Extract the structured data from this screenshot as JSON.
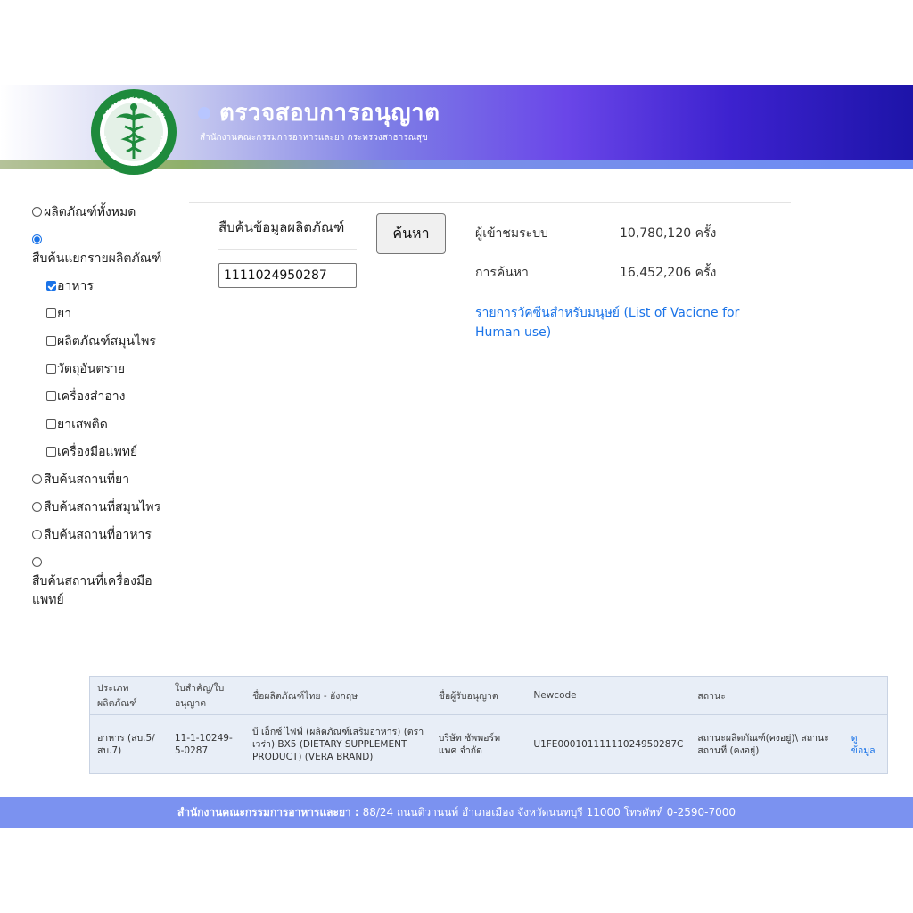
{
  "header": {
    "title": "ตรวจสอบการอนุญาต",
    "subtitle": "สำนักงานคณะกรรมการอาหารและยา กระทรวงสาธารณสุข",
    "logo_top_text": "กระทรวงสาธารณสุข",
    "logo_bottom_text": "MINISTRY OF PUBLIC HEALTH",
    "colors": {
      "banner_start": "#ffffff",
      "banner_mid": "#7e7fe6",
      "banner_end": "#1d14a8",
      "logo_green": "#1e8a3c"
    }
  },
  "sidebar": {
    "options": [
      {
        "label": "ผลิตภัณฑ์ทั้งหมด",
        "checked": false
      },
      {
        "label": "สืบค้นแยกรายผลิตภัณฑ์",
        "checked": true
      },
      {
        "label": "สืบค้นสถานที่ยา",
        "checked": false
      },
      {
        "label": "สืบค้นสถานที่สมุนไพร",
        "checked": false
      },
      {
        "label": "สืบค้นสถานที่อาหาร",
        "checked": false
      },
      {
        "label": "สืบค้นสถานที่เครื่องมือแพทย์",
        "checked": false
      }
    ],
    "categories": [
      {
        "label": "อาหาร",
        "checked": true
      },
      {
        "label": "ยา",
        "checked": false
      },
      {
        "label": "ผลิตภัณฑ์สมุนไพร",
        "checked": false
      },
      {
        "label": "วัตถุอันตราย",
        "checked": false
      },
      {
        "label": "เครื่องสำอาง",
        "checked": false
      },
      {
        "label": "ยาเสพติด",
        "checked": false
      },
      {
        "label": "เครื่องมือแพทย์",
        "checked": false
      }
    ]
  },
  "search": {
    "label": "สืบค้นข้อมูลผลิตภัณฑ์",
    "button": "ค้นหา",
    "value": "1111024950287"
  },
  "stats": {
    "visitors_label": "ผู้เข้าชมระบบ",
    "visitors_value": "10,780,120 ครั้ง",
    "searches_label": "การค้นหา",
    "searches_value": "16,452,206 ครั้ง",
    "vaccine_link": "รายการวัคซีนสำหรับมนุษย์ (List of Vacicne for Human use)"
  },
  "table": {
    "headers": [
      "ประเภทผลิตภัณฑ์",
      "ใบสำคัญ/ใบอนุญาต",
      "ชื่อผลิตภัณฑ์ไทย - อังกฤษ",
      "ชื่อผู้รับอนุญาต",
      "Newcode",
      "สถานะ",
      ""
    ],
    "rows": [
      {
        "type": "อาหาร (สบ.5/สบ.7)",
        "license": "11-1-10249-5-0287",
        "product_name": "บี เอ็กซ์ ไฟฟ์ (ผลิตภัณฑ์เสริมอาหาร) (ตราเวร่า) BX5 (DIETARY SUPPLEMENT PRODUCT) (VERA BRAND)",
        "licensee": "บริษัท ซัพพอร์ท แพค จำกัด",
        "newcode": "U1FE00010111111024950287C",
        "status": "สถานะผลิตภัณฑ์(คงอยู่)\\ สถานะสถานที่ (คงอยู่)",
        "action": "ดูข้อมูล"
      }
    ]
  },
  "footer": {
    "org": "สำนักงานคณะกรรมการอาหารและยา :",
    "address": "88/24 ถนนติวานนท์ อำเภอเมือง จังหวัดนนทบุรี 11000 โทรศัพท์ 0-2590-7000"
  }
}
